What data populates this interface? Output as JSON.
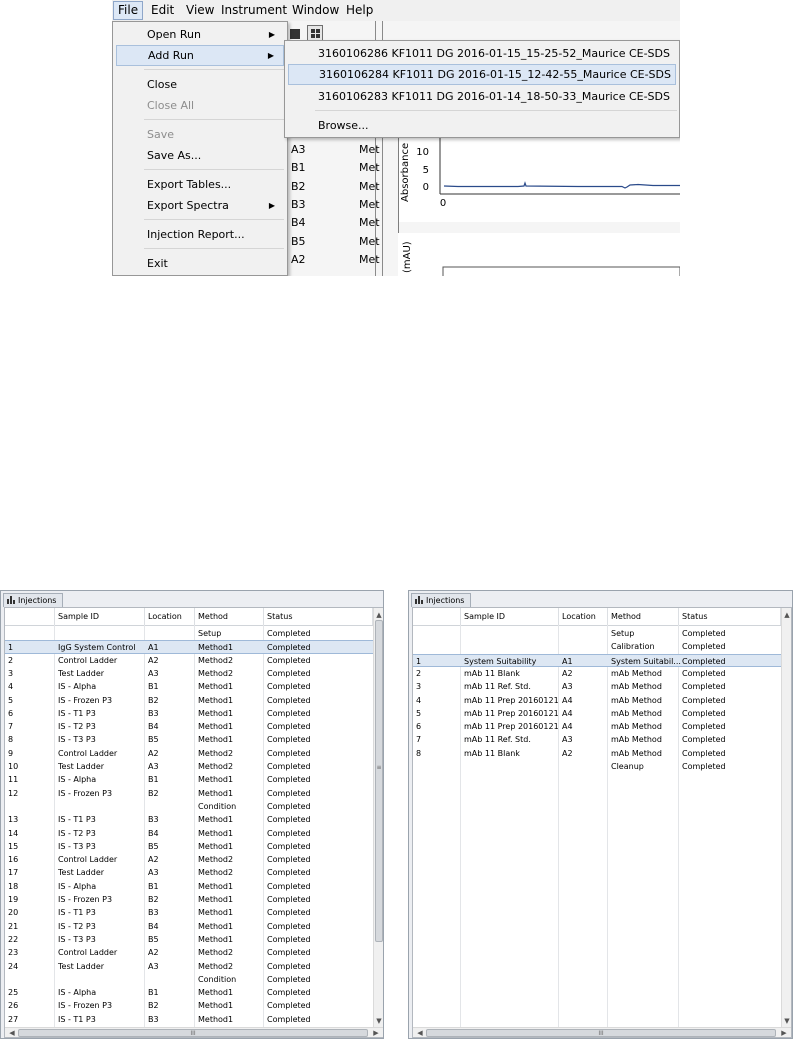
{
  "menubar": [
    "File",
    "Edit",
    "View",
    "Instrument",
    "Window",
    "Help"
  ],
  "file_menu": {
    "items": [
      {
        "label": "Open Run",
        "submenu": true,
        "disabled": false
      },
      {
        "label": "Add Run",
        "submenu": true,
        "disabled": false,
        "highlighted": true
      },
      {
        "label": "Close",
        "submenu": false,
        "disabled": false
      },
      {
        "label": "Close All",
        "submenu": false,
        "disabled": true
      },
      {
        "label": "Save",
        "submenu": false,
        "disabled": true
      },
      {
        "label": "Save As...",
        "submenu": false,
        "disabled": false
      },
      {
        "label": "Export Tables...",
        "submenu": false,
        "disabled": false
      },
      {
        "label": "Export Spectra",
        "submenu": true,
        "disabled": false
      },
      {
        "label": "Injection Report...",
        "submenu": false,
        "disabled": false
      },
      {
        "label": "Exit",
        "submenu": false,
        "disabled": false
      }
    ]
  },
  "add_run_submenu": {
    "runs": [
      "3160106286 KF1011 DG 2016-01-15_15-25-52_Maurice CE-SDS",
      "3160106284 KF1011 DG 2016-01-15_12-42-55_Maurice CE-SDS",
      "3160106283 KF1011 DG 2016-01-14_18-50-33_Maurice CE-SDS"
    ],
    "browse": "Browse..."
  },
  "background_table": {
    "rows": [
      {
        "loc": "A3",
        "method": "Met"
      },
      {
        "loc": "B1",
        "method": "Met"
      },
      {
        "loc": "B2",
        "method": "Met"
      },
      {
        "loc": "B3",
        "method": "Met"
      },
      {
        "loc": "B4",
        "method": "Met"
      },
      {
        "loc": "B5",
        "method": "Met"
      },
      {
        "loc": "A2",
        "method": "Met"
      }
    ]
  },
  "chart": {
    "ylabel": "Absorbance",
    "yticks": [
      "10",
      "5",
      "0"
    ],
    "xtick": "0",
    "ylabel2": "(mAU)"
  },
  "left_panel": {
    "tab": "Injections",
    "headers": [
      "Sample ID",
      "Location",
      "Method",
      "Status"
    ],
    "rows": [
      {
        "n": "",
        "sample": "",
        "loc": "",
        "method": "Setup",
        "status": "Completed"
      },
      {
        "n": "1",
        "sample": "IgG System Control",
        "loc": "A1",
        "method": "Method1",
        "status": "Completed",
        "selected": true
      },
      {
        "n": "2",
        "sample": "Control Ladder",
        "loc": "A2",
        "method": "Method2",
        "status": "Completed"
      },
      {
        "n": "3",
        "sample": "Test Ladder",
        "loc": "A3",
        "method": "Method2",
        "status": "Completed"
      },
      {
        "n": "4",
        "sample": "IS - Alpha",
        "loc": "B1",
        "method": "Method1",
        "status": "Completed"
      },
      {
        "n": "5",
        "sample": "IS - Frozen P3",
        "loc": "B2",
        "method": "Method1",
        "status": "Completed"
      },
      {
        "n": "6",
        "sample": "IS - T1 P3",
        "loc": "B3",
        "method": "Method1",
        "status": "Completed"
      },
      {
        "n": "7",
        "sample": "IS - T2 P3",
        "loc": "B4",
        "method": "Method1",
        "status": "Completed"
      },
      {
        "n": "8",
        "sample": "IS - T3 P3",
        "loc": "B5",
        "method": "Method1",
        "status": "Completed"
      },
      {
        "n": "9",
        "sample": "Control Ladder",
        "loc": "A2",
        "method": "Method2",
        "status": "Completed"
      },
      {
        "n": "10",
        "sample": "Test Ladder",
        "loc": "A3",
        "method": "Method2",
        "status": "Completed"
      },
      {
        "n": "11",
        "sample": "IS - Alpha",
        "loc": "B1",
        "method": "Method1",
        "status": "Completed"
      },
      {
        "n": "12",
        "sample": "IS - Frozen P3",
        "loc": "B2",
        "method": "Method1",
        "status": "Completed"
      },
      {
        "n": "",
        "sample": "",
        "loc": "",
        "method": "Condition",
        "status": "Completed"
      },
      {
        "n": "13",
        "sample": "IS - T1 P3",
        "loc": "B3",
        "method": "Method1",
        "status": "Completed"
      },
      {
        "n": "14",
        "sample": "IS - T2 P3",
        "loc": "B4",
        "method": "Method1",
        "status": "Completed"
      },
      {
        "n": "15",
        "sample": "IS - T3 P3",
        "loc": "B5",
        "method": "Method1",
        "status": "Completed"
      },
      {
        "n": "16",
        "sample": "Control Ladder",
        "loc": "A2",
        "method": "Method2",
        "status": "Completed"
      },
      {
        "n": "17",
        "sample": "Test Ladder",
        "loc": "A3",
        "method": "Method2",
        "status": "Completed"
      },
      {
        "n": "18",
        "sample": "IS - Alpha",
        "loc": "B1",
        "method": "Method1",
        "status": "Completed"
      },
      {
        "n": "19",
        "sample": "IS - Frozen P3",
        "loc": "B2",
        "method": "Method1",
        "status": "Completed"
      },
      {
        "n": "20",
        "sample": "IS - T1 P3",
        "loc": "B3",
        "method": "Method1",
        "status": "Completed"
      },
      {
        "n": "21",
        "sample": "IS - T2 P3",
        "loc": "B4",
        "method": "Method1",
        "status": "Completed"
      },
      {
        "n": "22",
        "sample": "IS - T3 P3",
        "loc": "B5",
        "method": "Method1",
        "status": "Completed"
      },
      {
        "n": "23",
        "sample": "Control Ladder",
        "loc": "A2",
        "method": "Method2",
        "status": "Completed"
      },
      {
        "n": "24",
        "sample": "Test Ladder",
        "loc": "A3",
        "method": "Method2",
        "status": "Completed"
      },
      {
        "n": "",
        "sample": "",
        "loc": "",
        "method": "Condition",
        "status": "Completed"
      },
      {
        "n": "25",
        "sample": "IS - Alpha",
        "loc": "B1",
        "method": "Method1",
        "status": "Completed"
      },
      {
        "n": "26",
        "sample": "IS - Frozen P3",
        "loc": "B2",
        "method": "Method1",
        "status": "Completed"
      },
      {
        "n": "27",
        "sample": "IS - T1 P3",
        "loc": "B3",
        "method": "Method1",
        "status": "Completed"
      }
    ]
  },
  "right_panel": {
    "tab": "Injections",
    "headers": [
      "Sample ID",
      "Location",
      "Method",
      "Status"
    ],
    "rows": [
      {
        "n": "",
        "sample": "",
        "loc": "",
        "method": "Setup",
        "status": "Completed"
      },
      {
        "n": "",
        "sample": "",
        "loc": "",
        "method": "Calibration",
        "status": "Completed"
      },
      {
        "n": "1",
        "sample": "System Suitability",
        "loc": "A1",
        "method": "System Suitabil...",
        "status": "Completed",
        "selected": true
      },
      {
        "n": "2",
        "sample": "mAb 11 Blank",
        "loc": "A2",
        "method": "mAb Method",
        "status": "Completed"
      },
      {
        "n": "3",
        "sample": "mAb 11 Ref. Std.",
        "loc": "A3",
        "method": "mAb Method",
        "status": "Completed"
      },
      {
        "n": "4",
        "sample": "mAb 11 Prep 20160121",
        "loc": "A4",
        "method": "mAb Method",
        "status": "Completed"
      },
      {
        "n": "5",
        "sample": "mAb 11 Prep 20160121",
        "loc": "A4",
        "method": "mAb Method",
        "status": "Completed"
      },
      {
        "n": "6",
        "sample": "mAb 11 Prep 20160121",
        "loc": "A4",
        "method": "mAb Method",
        "status": "Completed"
      },
      {
        "n": "7",
        "sample": "mAb 11 Ref. Std.",
        "loc": "A3",
        "method": "mAb Method",
        "status": "Completed"
      },
      {
        "n": "8",
        "sample": "mAb 11 Blank",
        "loc": "A2",
        "method": "mAb Method",
        "status": "Completed"
      },
      {
        "n": "",
        "sample": "",
        "loc": "",
        "method": "Cleanup",
        "status": "Completed"
      }
    ]
  },
  "scroll_grip": "III",
  "colors": {
    "selection": "#dde7f3",
    "menu_highlight": "#dce7f5",
    "trace": "#2a4a8a"
  }
}
